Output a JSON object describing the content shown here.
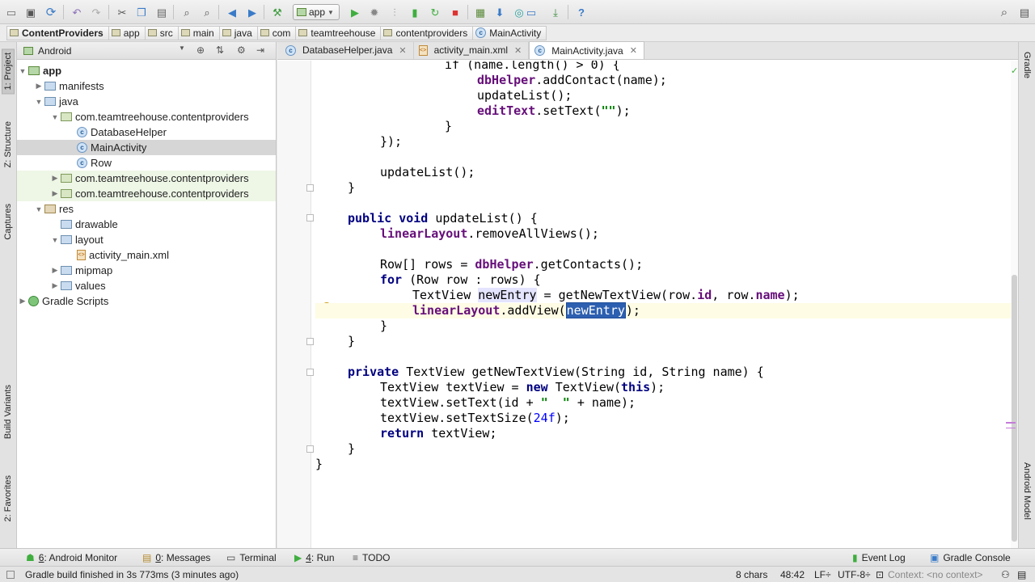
{
  "toolbar": {
    "run_config": "app",
    "icons": [
      "folder-open-icon",
      "save-icon",
      "sync-icon",
      "undo-icon",
      "redo-icon",
      "cut-icon",
      "copy-icon",
      "paste-icon",
      "find-icon",
      "replace-icon",
      "back-icon",
      "forward-icon",
      "make-project-icon",
      "run-icon",
      "debug-icon",
      "attach-debugger-icon",
      "run-with-coverage-icon",
      "apply-changes-icon",
      "stop-icon",
      "avd-manager-icon",
      "sdk-manager-icon",
      "project-structure-icon",
      "gradle-sync-icon",
      "help-icon",
      "search-icon"
    ]
  },
  "breadcrumb": [
    "ContentProviders",
    "app",
    "src",
    "main",
    "java",
    "com",
    "teamtreehouse",
    "contentproviders",
    "MainActivity"
  ],
  "left_strip": {
    "project": "1: Project",
    "structure": "Z: Structure",
    "captures": "Captures",
    "build_variants": "Build Variants",
    "favorites": "2: Favorites"
  },
  "right_strip": {
    "gradle": "Gradle",
    "android_model": "Android Model"
  },
  "project_panel": {
    "view_mode": "Android",
    "tree": [
      {
        "label": "app",
        "type": "module",
        "arrow": "▼",
        "indent": 0
      },
      {
        "label": "manifests",
        "type": "folder",
        "arrow": "▶",
        "indent": 1
      },
      {
        "label": "java",
        "type": "folder",
        "arrow": "▼",
        "indent": 1
      },
      {
        "label": "com.teamtreehouse.contentproviders",
        "type": "pkg",
        "arrow": "▼",
        "indent": 2
      },
      {
        "label": "DatabaseHelper",
        "type": "class",
        "arrow": "",
        "indent": 3
      },
      {
        "label": "MainActivity",
        "type": "class",
        "arrow": "",
        "indent": 3,
        "selected": true
      },
      {
        "label": "Row",
        "type": "class",
        "arrow": "",
        "indent": 3
      },
      {
        "label": "com.teamtreehouse.contentproviders",
        "type": "pkg",
        "arrow": "▶",
        "indent": 2,
        "tint": true
      },
      {
        "label": "com.teamtreehouse.contentproviders",
        "type": "pkg",
        "arrow": "▶",
        "indent": 2,
        "tint": true
      },
      {
        "label": "res",
        "type": "res",
        "arrow": "▼",
        "indent": 1
      },
      {
        "label": "drawable",
        "type": "folder",
        "arrow": "",
        "indent": 2
      },
      {
        "label": "layout",
        "type": "folder",
        "arrow": "▼",
        "indent": 2
      },
      {
        "label": "activity_main.xml",
        "type": "xml",
        "arrow": "",
        "indent": 3
      },
      {
        "label": "mipmap",
        "type": "folder",
        "arrow": "▶",
        "indent": 2
      },
      {
        "label": "values",
        "type": "folder",
        "arrow": "▶",
        "indent": 2
      },
      {
        "label": "Gradle Scripts",
        "type": "gradle",
        "arrow": "▶",
        "indent": 0
      }
    ]
  },
  "tabs": [
    {
      "label": "DatabaseHelper.java",
      "icon": "class",
      "active": false
    },
    {
      "label": "activity_main.xml",
      "icon": "xml",
      "active": false
    },
    {
      "label": "MainActivity.java",
      "icon": "class",
      "active": true
    }
  ],
  "code": {
    "l0": "if (name.length() > 0) {",
    "l1a": "dbHelper",
    "l1b": ".addContact(name);",
    "l2": "updateList();",
    "l3a": "editText",
    "l3b": ".setText(",
    "l3c": "\"\"",
    "l3d": ");",
    "l4": "}",
    "l5": "});",
    "l7": "updateList();",
    "l8": "}",
    "l10a": "public void",
    "l10b": " updateList() {",
    "l11a": "linearLayout",
    "l11b": ".removeAllViews();",
    "l13a": "Row[] rows = ",
    "l13b": "dbHelper",
    "l13c": ".getContacts();",
    "l14a": "for",
    "l14b": " (Row row : rows) {",
    "l15a": "TextView ",
    "l15b": "newEntry",
    "l15c": " = getNewTextView(row.",
    "l15d": "id",
    "l15e": ", row.",
    "l15f": "name",
    "l15g": ");",
    "l16a": "linearLayout",
    "l16b": ".addView(",
    "l16c": "newEntry",
    "l16d": ");",
    "l17": "}",
    "l18": "}",
    "l20a": "private",
    "l20b": " TextView getNewTextView(String id, String name) {",
    "l21a": "TextView textView = ",
    "l21b": "new",
    "l21c": " TextView(",
    "l21d": "this",
    "l21e": ");",
    "l22a": "textView.setText(id + ",
    "l22b": "\"  \"",
    "l22c": " + name);",
    "l23a": "textView.setTextSize(",
    "l23b": "24f",
    "l23c": ");",
    "l24a": "return",
    "l24b": " textView;",
    "l25": "}",
    "l26": "}"
  },
  "bottom_tabs": {
    "android_monitor": {
      "num": "6",
      "text": ": Android Monitor"
    },
    "messages": {
      "num": "0",
      "text": ": Messages"
    },
    "terminal": "Terminal",
    "run": {
      "num": "4",
      "text": ": Run"
    },
    "todo": "TODO",
    "event_log": "Event Log",
    "gradle_console": "Gradle Console"
  },
  "status": {
    "message": "Gradle build finished in 3s 773ms (3 minutes ago)",
    "chars": "8 chars",
    "position": "48:42",
    "line_sep": "LF÷",
    "encoding": "UTF-8÷",
    "context": "Context: <no context>"
  }
}
